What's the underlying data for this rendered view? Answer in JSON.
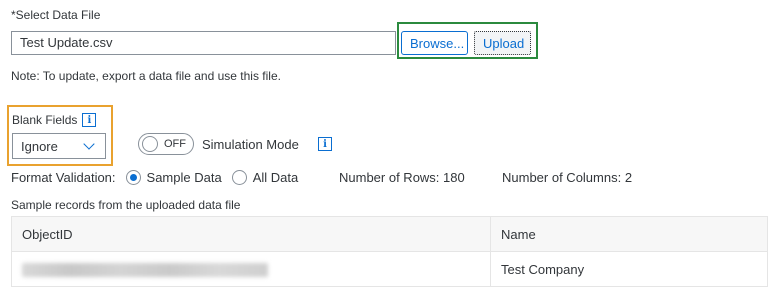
{
  "file_section": {
    "label": "*Select Data File",
    "file_value": "Test Update.csv",
    "browse_label": "Browse...",
    "upload_label": "Upload",
    "note": "Note: To update, export a data file and use this file."
  },
  "blank_fields": {
    "label": "Blank Fields",
    "selected": "Ignore"
  },
  "simulation": {
    "switch_text": "OFF",
    "label": "Simulation Mode"
  },
  "format_validation": {
    "label": "Format Validation:",
    "options": [
      "Sample Data",
      "All Data"
    ],
    "selected": "Sample Data",
    "rows_text": "Number of Rows: 180",
    "cols_text": "Number of Columns: 2"
  },
  "sample": {
    "caption": "Sample records from the uploaded data file",
    "columns": [
      "ObjectID",
      "Name"
    ],
    "rows": [
      {
        "name": "Test Company"
      }
    ]
  },
  "info_glyph": "i",
  "colors": {
    "accent": "#0a6ed1",
    "highlight_green": "#2b8a3e",
    "highlight_orange": "#e9a22f"
  },
  "icons": [
    "info-icon",
    "chevron-down-icon"
  ]
}
